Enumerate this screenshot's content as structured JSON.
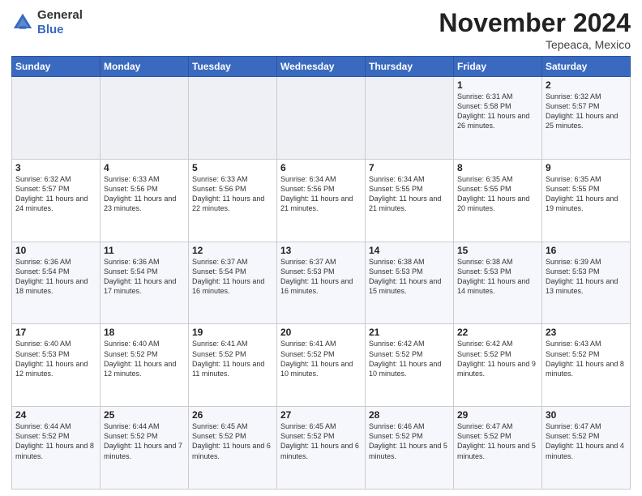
{
  "logo": {
    "general": "General",
    "blue": "Blue"
  },
  "header": {
    "month": "November 2024",
    "location": "Tepeaca, Mexico"
  },
  "weekdays": [
    "Sunday",
    "Monday",
    "Tuesday",
    "Wednesday",
    "Thursday",
    "Friday",
    "Saturday"
  ],
  "weeks": [
    [
      {
        "day": "",
        "info": ""
      },
      {
        "day": "",
        "info": ""
      },
      {
        "day": "",
        "info": ""
      },
      {
        "day": "",
        "info": ""
      },
      {
        "day": "",
        "info": ""
      },
      {
        "day": "1",
        "info": "Sunrise: 6:31 AM\nSunset: 5:58 PM\nDaylight: 11 hours and 26 minutes."
      },
      {
        "day": "2",
        "info": "Sunrise: 6:32 AM\nSunset: 5:57 PM\nDaylight: 11 hours and 25 minutes."
      }
    ],
    [
      {
        "day": "3",
        "info": "Sunrise: 6:32 AM\nSunset: 5:57 PM\nDaylight: 11 hours and 24 minutes."
      },
      {
        "day": "4",
        "info": "Sunrise: 6:33 AM\nSunset: 5:56 PM\nDaylight: 11 hours and 23 minutes."
      },
      {
        "day": "5",
        "info": "Sunrise: 6:33 AM\nSunset: 5:56 PM\nDaylight: 11 hours and 22 minutes."
      },
      {
        "day": "6",
        "info": "Sunrise: 6:34 AM\nSunset: 5:56 PM\nDaylight: 11 hours and 21 minutes."
      },
      {
        "day": "7",
        "info": "Sunrise: 6:34 AM\nSunset: 5:55 PM\nDaylight: 11 hours and 21 minutes."
      },
      {
        "day": "8",
        "info": "Sunrise: 6:35 AM\nSunset: 5:55 PM\nDaylight: 11 hours and 20 minutes."
      },
      {
        "day": "9",
        "info": "Sunrise: 6:35 AM\nSunset: 5:55 PM\nDaylight: 11 hours and 19 minutes."
      }
    ],
    [
      {
        "day": "10",
        "info": "Sunrise: 6:36 AM\nSunset: 5:54 PM\nDaylight: 11 hours and 18 minutes."
      },
      {
        "day": "11",
        "info": "Sunrise: 6:36 AM\nSunset: 5:54 PM\nDaylight: 11 hours and 17 minutes."
      },
      {
        "day": "12",
        "info": "Sunrise: 6:37 AM\nSunset: 5:54 PM\nDaylight: 11 hours and 16 minutes."
      },
      {
        "day": "13",
        "info": "Sunrise: 6:37 AM\nSunset: 5:53 PM\nDaylight: 11 hours and 16 minutes."
      },
      {
        "day": "14",
        "info": "Sunrise: 6:38 AM\nSunset: 5:53 PM\nDaylight: 11 hours and 15 minutes."
      },
      {
        "day": "15",
        "info": "Sunrise: 6:38 AM\nSunset: 5:53 PM\nDaylight: 11 hours and 14 minutes."
      },
      {
        "day": "16",
        "info": "Sunrise: 6:39 AM\nSunset: 5:53 PM\nDaylight: 11 hours and 13 minutes."
      }
    ],
    [
      {
        "day": "17",
        "info": "Sunrise: 6:40 AM\nSunset: 5:53 PM\nDaylight: 11 hours and 12 minutes."
      },
      {
        "day": "18",
        "info": "Sunrise: 6:40 AM\nSunset: 5:52 PM\nDaylight: 11 hours and 12 minutes."
      },
      {
        "day": "19",
        "info": "Sunrise: 6:41 AM\nSunset: 5:52 PM\nDaylight: 11 hours and 11 minutes."
      },
      {
        "day": "20",
        "info": "Sunrise: 6:41 AM\nSunset: 5:52 PM\nDaylight: 11 hours and 10 minutes."
      },
      {
        "day": "21",
        "info": "Sunrise: 6:42 AM\nSunset: 5:52 PM\nDaylight: 11 hours and 10 minutes."
      },
      {
        "day": "22",
        "info": "Sunrise: 6:42 AM\nSunset: 5:52 PM\nDaylight: 11 hours and 9 minutes."
      },
      {
        "day": "23",
        "info": "Sunrise: 6:43 AM\nSunset: 5:52 PM\nDaylight: 11 hours and 8 minutes."
      }
    ],
    [
      {
        "day": "24",
        "info": "Sunrise: 6:44 AM\nSunset: 5:52 PM\nDaylight: 11 hours and 8 minutes."
      },
      {
        "day": "25",
        "info": "Sunrise: 6:44 AM\nSunset: 5:52 PM\nDaylight: 11 hours and 7 minutes."
      },
      {
        "day": "26",
        "info": "Sunrise: 6:45 AM\nSunset: 5:52 PM\nDaylight: 11 hours and 6 minutes."
      },
      {
        "day": "27",
        "info": "Sunrise: 6:45 AM\nSunset: 5:52 PM\nDaylight: 11 hours and 6 minutes."
      },
      {
        "day": "28",
        "info": "Sunrise: 6:46 AM\nSunset: 5:52 PM\nDaylight: 11 hours and 5 minutes."
      },
      {
        "day": "29",
        "info": "Sunrise: 6:47 AM\nSunset: 5:52 PM\nDaylight: 11 hours and 5 minutes."
      },
      {
        "day": "30",
        "info": "Sunrise: 6:47 AM\nSunset: 5:52 PM\nDaylight: 11 hours and 4 minutes."
      }
    ]
  ]
}
